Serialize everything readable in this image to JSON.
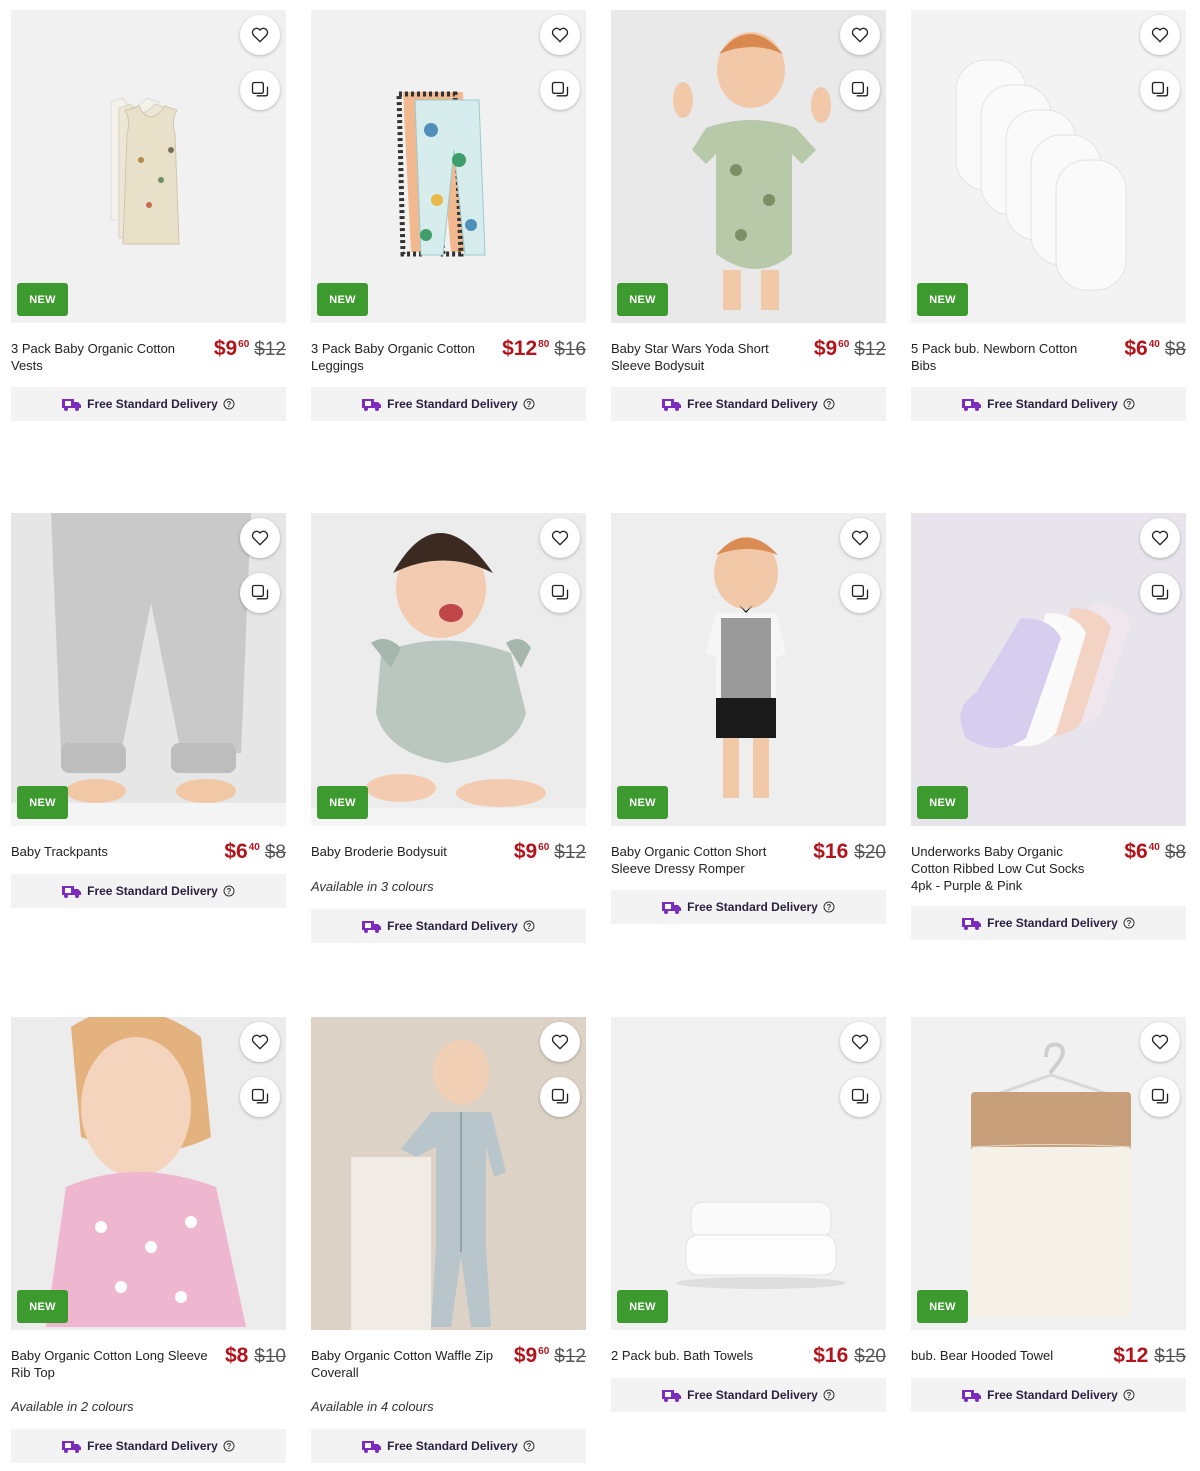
{
  "badge_text": "NEW",
  "delivery_text": "Free Standard Delivery",
  "colors": {
    "price": "#b3131b",
    "badge": "#3d9a2e",
    "delivery_bg": "#f3f3f3",
    "delivery_icon": "#7b2cbf"
  },
  "products": [
    {
      "name": "3 Pack Baby Organic Cotton Vests",
      "price_main": "$9",
      "price_cents": "60",
      "was": "$12",
      "colours": "",
      "image_icon": "vest-icon"
    },
    {
      "name": "3 Pack Baby Organic Cotton Leggings",
      "price_main": "$12",
      "price_cents": "80",
      "was": "$16",
      "colours": "",
      "image_icon": "leggings-icon"
    },
    {
      "name": "Baby Star Wars Yoda Short Sleeve Bodysuit",
      "price_main": "$9",
      "price_cents": "60",
      "was": "$12",
      "colours": "",
      "image_icon": "bodysuit-icon"
    },
    {
      "name": "5 Pack bub. Newborn Cotton Bibs",
      "price_main": "$6",
      "price_cents": "40",
      "was": "$8",
      "colours": "",
      "image_icon": "bib-icon"
    },
    {
      "name": "Baby Trackpants",
      "price_main": "$6",
      "price_cents": "40",
      "was": "$8",
      "colours": "",
      "image_icon": "trackpants-icon"
    },
    {
      "name": "Baby Broderie Bodysuit",
      "price_main": "$9",
      "price_cents": "60",
      "was": "$12",
      "colours": "Available in 3 colours",
      "image_icon": "bodysuit-icon"
    },
    {
      "name": "Baby Organic Cotton Short Sleeve Dressy Romper",
      "price_main": "$16",
      "price_cents": "",
      "was": "$20",
      "colours": "",
      "image_icon": "romper-icon"
    },
    {
      "name": "Underworks Baby Organic Cotton Ribbed Low Cut Socks 4pk - Purple & Pink",
      "price_main": "$6",
      "price_cents": "40",
      "was": "$8",
      "colours": "",
      "image_icon": "socks-icon"
    },
    {
      "name": "Baby Organic Cotton Long Sleeve Rib Top",
      "price_main": "$8",
      "price_cents": "",
      "was": "$10",
      "colours": "Available in 2 colours",
      "image_icon": "top-icon"
    },
    {
      "name": "Baby Organic Cotton Waffle Zip Coverall",
      "price_main": "$9",
      "price_cents": "60",
      "was": "$12",
      "colours": "Available in 4 colours",
      "image_icon": "coverall-icon"
    },
    {
      "name": "2 Pack bub. Bath Towels",
      "price_main": "$16",
      "price_cents": "",
      "was": "$20",
      "colours": "",
      "image_icon": "towel-icon"
    },
    {
      "name": "bub. Bear Hooded Towel",
      "price_main": "$12",
      "price_cents": "",
      "was": "$15",
      "colours": "",
      "image_icon": "hooded-towel-icon"
    }
  ]
}
